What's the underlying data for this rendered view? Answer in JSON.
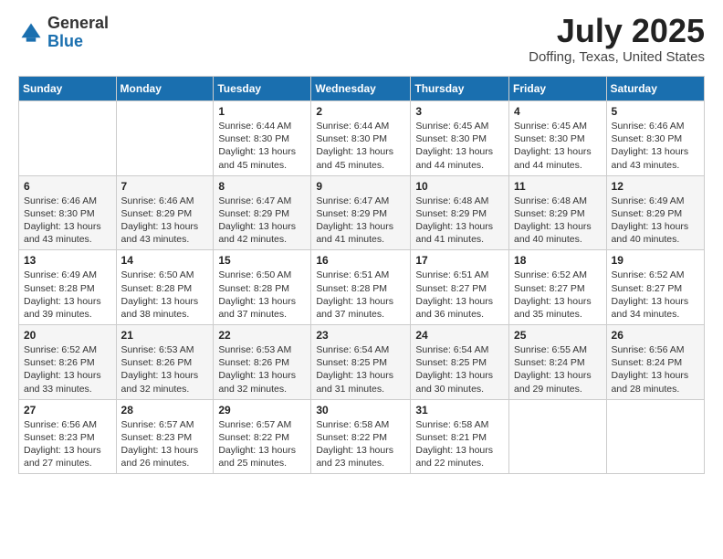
{
  "logo": {
    "general": "General",
    "blue": "Blue"
  },
  "header": {
    "month": "July 2025",
    "location": "Doffing, Texas, United States"
  },
  "weekdays": [
    "Sunday",
    "Monday",
    "Tuesday",
    "Wednesday",
    "Thursday",
    "Friday",
    "Saturday"
  ],
  "weeks": [
    [
      {
        "day": "",
        "info": ""
      },
      {
        "day": "",
        "info": ""
      },
      {
        "day": "1",
        "info": "Sunrise: 6:44 AM\nSunset: 8:30 PM\nDaylight: 13 hours and 45 minutes."
      },
      {
        "day": "2",
        "info": "Sunrise: 6:44 AM\nSunset: 8:30 PM\nDaylight: 13 hours and 45 minutes."
      },
      {
        "day": "3",
        "info": "Sunrise: 6:45 AM\nSunset: 8:30 PM\nDaylight: 13 hours and 44 minutes."
      },
      {
        "day": "4",
        "info": "Sunrise: 6:45 AM\nSunset: 8:30 PM\nDaylight: 13 hours and 44 minutes."
      },
      {
        "day": "5",
        "info": "Sunrise: 6:46 AM\nSunset: 8:30 PM\nDaylight: 13 hours and 43 minutes."
      }
    ],
    [
      {
        "day": "6",
        "info": "Sunrise: 6:46 AM\nSunset: 8:30 PM\nDaylight: 13 hours and 43 minutes."
      },
      {
        "day": "7",
        "info": "Sunrise: 6:46 AM\nSunset: 8:29 PM\nDaylight: 13 hours and 43 minutes."
      },
      {
        "day": "8",
        "info": "Sunrise: 6:47 AM\nSunset: 8:29 PM\nDaylight: 13 hours and 42 minutes."
      },
      {
        "day": "9",
        "info": "Sunrise: 6:47 AM\nSunset: 8:29 PM\nDaylight: 13 hours and 41 minutes."
      },
      {
        "day": "10",
        "info": "Sunrise: 6:48 AM\nSunset: 8:29 PM\nDaylight: 13 hours and 41 minutes."
      },
      {
        "day": "11",
        "info": "Sunrise: 6:48 AM\nSunset: 8:29 PM\nDaylight: 13 hours and 40 minutes."
      },
      {
        "day": "12",
        "info": "Sunrise: 6:49 AM\nSunset: 8:29 PM\nDaylight: 13 hours and 40 minutes."
      }
    ],
    [
      {
        "day": "13",
        "info": "Sunrise: 6:49 AM\nSunset: 8:28 PM\nDaylight: 13 hours and 39 minutes."
      },
      {
        "day": "14",
        "info": "Sunrise: 6:50 AM\nSunset: 8:28 PM\nDaylight: 13 hours and 38 minutes."
      },
      {
        "day": "15",
        "info": "Sunrise: 6:50 AM\nSunset: 8:28 PM\nDaylight: 13 hours and 37 minutes."
      },
      {
        "day": "16",
        "info": "Sunrise: 6:51 AM\nSunset: 8:28 PM\nDaylight: 13 hours and 37 minutes."
      },
      {
        "day": "17",
        "info": "Sunrise: 6:51 AM\nSunset: 8:27 PM\nDaylight: 13 hours and 36 minutes."
      },
      {
        "day": "18",
        "info": "Sunrise: 6:52 AM\nSunset: 8:27 PM\nDaylight: 13 hours and 35 minutes."
      },
      {
        "day": "19",
        "info": "Sunrise: 6:52 AM\nSunset: 8:27 PM\nDaylight: 13 hours and 34 minutes."
      }
    ],
    [
      {
        "day": "20",
        "info": "Sunrise: 6:52 AM\nSunset: 8:26 PM\nDaylight: 13 hours and 33 minutes."
      },
      {
        "day": "21",
        "info": "Sunrise: 6:53 AM\nSunset: 8:26 PM\nDaylight: 13 hours and 32 minutes."
      },
      {
        "day": "22",
        "info": "Sunrise: 6:53 AM\nSunset: 8:26 PM\nDaylight: 13 hours and 32 minutes."
      },
      {
        "day": "23",
        "info": "Sunrise: 6:54 AM\nSunset: 8:25 PM\nDaylight: 13 hours and 31 minutes."
      },
      {
        "day": "24",
        "info": "Sunrise: 6:54 AM\nSunset: 8:25 PM\nDaylight: 13 hours and 30 minutes."
      },
      {
        "day": "25",
        "info": "Sunrise: 6:55 AM\nSunset: 8:24 PM\nDaylight: 13 hours and 29 minutes."
      },
      {
        "day": "26",
        "info": "Sunrise: 6:56 AM\nSunset: 8:24 PM\nDaylight: 13 hours and 28 minutes."
      }
    ],
    [
      {
        "day": "27",
        "info": "Sunrise: 6:56 AM\nSunset: 8:23 PM\nDaylight: 13 hours and 27 minutes."
      },
      {
        "day": "28",
        "info": "Sunrise: 6:57 AM\nSunset: 8:23 PM\nDaylight: 13 hours and 26 minutes."
      },
      {
        "day": "29",
        "info": "Sunrise: 6:57 AM\nSunset: 8:22 PM\nDaylight: 13 hours and 25 minutes."
      },
      {
        "day": "30",
        "info": "Sunrise: 6:58 AM\nSunset: 8:22 PM\nDaylight: 13 hours and 23 minutes."
      },
      {
        "day": "31",
        "info": "Sunrise: 6:58 AM\nSunset: 8:21 PM\nDaylight: 13 hours and 22 minutes."
      },
      {
        "day": "",
        "info": ""
      },
      {
        "day": "",
        "info": ""
      }
    ]
  ]
}
